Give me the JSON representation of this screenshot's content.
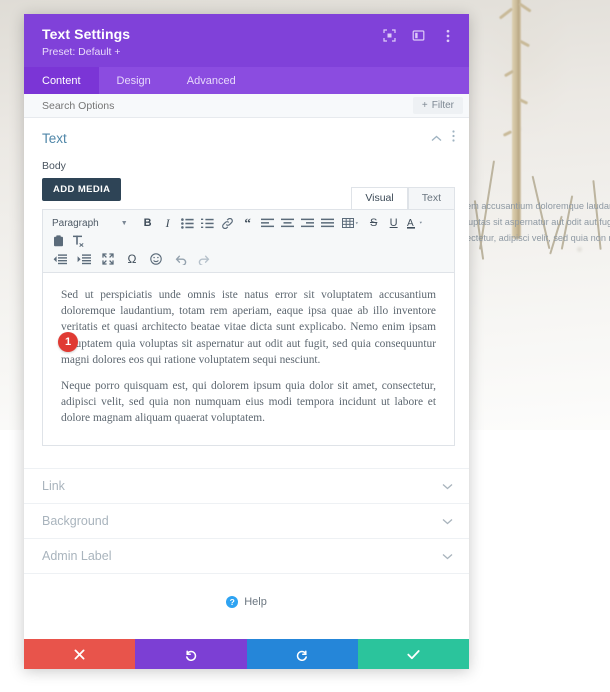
{
  "background": {
    "photo_alt": "snowy-ground-with-sapling-photo",
    "page_text_lines": [
      "em accusantium doloremque laudanti",
      "luptas sit aspernatur aut odit aut fugi",
      "ectetur, adipisci velit, sed quia non nu"
    ]
  },
  "modal": {
    "title": "Text Settings",
    "preset": "Preset: Default +",
    "header_icons": [
      {
        "name": "fullscreen-expand-icon"
      },
      {
        "name": "layout-panel-icon"
      },
      {
        "name": "more-options-vertical-icon"
      }
    ],
    "tabs": [
      {
        "label": "Content",
        "active": true
      },
      {
        "label": "Design",
        "active": false
      },
      {
        "label": "Advanced",
        "active": false
      }
    ],
    "search": {
      "placeholder": "Search Options",
      "value": ""
    },
    "filter_button": "Filter",
    "filter_icon": "plus-icon",
    "section": {
      "title": "Text",
      "collapse_icon": "chevron-up-icon",
      "menu_icon": "more-options-vertical-icon"
    },
    "field": {
      "label": "Body",
      "add_media_button": "ADD MEDIA",
      "editor_tabs": [
        {
          "label": "Visual",
          "active": true
        },
        {
          "label": "Text",
          "active": false
        }
      ],
      "format_select": "Paragraph",
      "toolbar_row1": [
        {
          "name": "bold-icon",
          "glyph": "B"
        },
        {
          "name": "italic-icon",
          "glyph": "I"
        },
        {
          "name": "bulleted-list-icon"
        },
        {
          "name": "numbered-list-icon"
        },
        {
          "name": "link-icon"
        },
        {
          "name": "blockquote-icon",
          "glyph": "“"
        },
        {
          "name": "align-left-icon"
        },
        {
          "name": "align-center-icon"
        },
        {
          "name": "align-right-icon"
        },
        {
          "name": "align-justify-icon"
        },
        {
          "name": "table-icon"
        },
        {
          "name": "strikethrough-icon",
          "glyph": "S"
        },
        {
          "name": "underline-icon",
          "glyph": "U"
        },
        {
          "name": "text-color-icon",
          "glyph": "A"
        },
        {
          "name": "paste-as-text-icon"
        },
        {
          "name": "clear-formatting-icon"
        }
      ],
      "toolbar_row2": [
        {
          "name": "outdent-icon"
        },
        {
          "name": "indent-icon"
        },
        {
          "name": "fullscreen-icon"
        },
        {
          "name": "special-character-icon",
          "glyph": "Ω"
        },
        {
          "name": "emoji-icon"
        },
        {
          "name": "undo-icon"
        },
        {
          "name": "redo-icon"
        }
      ],
      "badge_number": "1",
      "paragraphs": [
        "Sed ut perspiciatis unde omnis iste natus error sit voluptatem accusantium doloremque laudantium, totam rem aperiam, eaque ipsa quae ab illo inventore veritatis et quasi architecto beatae vitae dicta sunt explicabo. Nemo enim ipsam voluptatem quia voluptas sit aspernatur aut odit aut fugit, sed quia consequuntur magni dolores eos qui ratione voluptatem sequi nesciunt.",
        "Neque porro quisquam est, qui dolorem ipsum quia dolor sit amet, consectetur, adipisci velit, sed quia non numquam eius modi tempora incidunt ut labore et dolore magnam aliquam quaerat voluptatem."
      ]
    },
    "accordions": [
      {
        "label": "Link",
        "caret": "chevron-down-icon"
      },
      {
        "label": "Background",
        "caret": "chevron-down-icon"
      },
      {
        "label": "Admin Label",
        "caret": "chevron-down-icon"
      }
    ],
    "help": {
      "label": "Help",
      "icon": "question-mark-icon"
    },
    "footer_buttons": [
      {
        "name": "cancel-button",
        "icon": "close-x-icon",
        "color": "#e8544b"
      },
      {
        "name": "undo-button",
        "icon": "undo-arrow-icon",
        "color": "#7c3fd4"
      },
      {
        "name": "redo-button",
        "icon": "redo-arrow-icon",
        "color": "#2586d9"
      },
      {
        "name": "save-button",
        "icon": "checkmark-icon",
        "color": "#2bc49c"
      }
    ]
  }
}
